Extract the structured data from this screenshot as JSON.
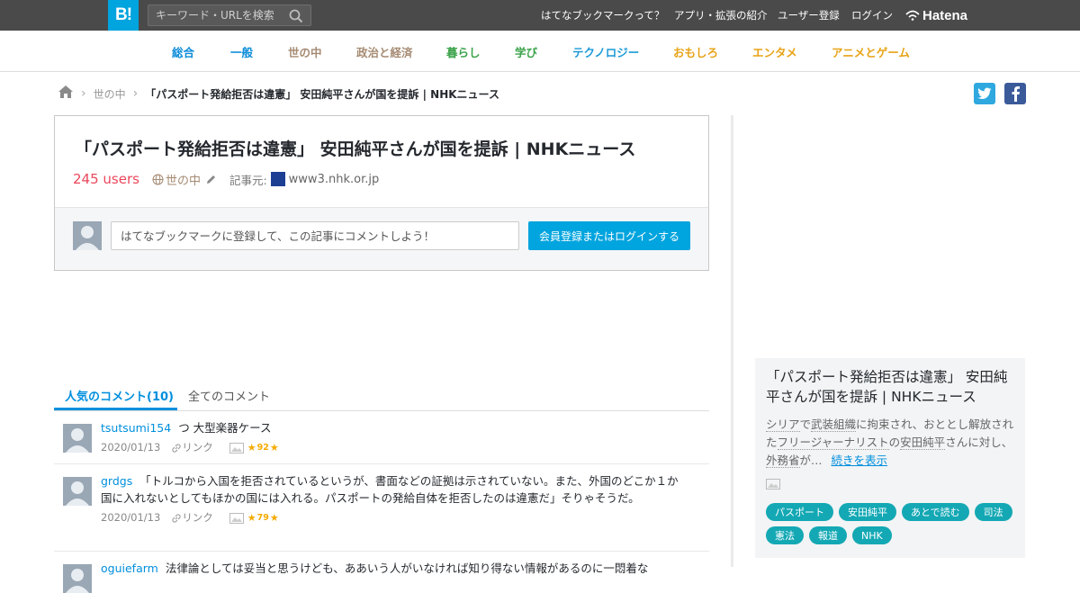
{
  "topbar": {
    "logo": "B!",
    "search_placeholder": "キーワード・URLを検索",
    "links": [
      "はてなブックマークって？",
      "アプリ・拡張の紹介",
      "ユーザー登録",
      "ログイン"
    ],
    "hatena": "Hatena"
  },
  "categories": [
    {
      "label": "総合",
      "color": "#0a8bd9"
    },
    {
      "label": "一般",
      "color": "#0a8bd9"
    },
    {
      "label": "世の中",
      "color": "#a58b73"
    },
    {
      "label": "政治と経済",
      "color": "#a58b73"
    },
    {
      "label": "暮らし",
      "color": "#3ba34a"
    },
    {
      "label": "学び",
      "color": "#3ba34a"
    },
    {
      "label": "テクノロジー",
      "color": "#1c9ad6"
    },
    {
      "label": "おもしろ",
      "color": "#e8a317"
    },
    {
      "label": "エンタメ",
      "color": "#e8a317"
    },
    {
      "label": "アニメとゲーム",
      "color": "#e8a317"
    }
  ],
  "breadcrumb": {
    "category": "世の中",
    "current": "「パスポート発給拒否は違憲」 安田純平さんが国を提訴 | NHKニュース"
  },
  "entry": {
    "title": "「パスポート発給拒否は違憲」 安田純平さんが国を提訴 | NHKニュース",
    "users": "245 users",
    "category": "世の中",
    "source_label": "記事元:",
    "source": "www3.nhk.or.jp",
    "comment_placeholder": "はてなブックマークに登録して、この記事にコメントしよう！",
    "login_button": "会員登録またはログインする"
  },
  "tabs": {
    "popular": "人気のコメント(10)",
    "all": "全てのコメント"
  },
  "comments": [
    {
      "user": "tsutsumi154",
      "text": "つ 大型楽器ケース",
      "date": "2020/01/13",
      "link": "リンク",
      "stars": "92"
    },
    {
      "user": "grdgs",
      "text": "「トルコから入国を拒否されているというが、書面などの証拠は示されていない。また、外国のどこか１か国に入れないとしてもほかの国には入れる。パスポートの発給自体を拒否したのは違憲だ」そりゃそうだ。",
      "date": "2020/01/13",
      "link": "リンク",
      "stars": "79"
    },
    {
      "user": "oguiefarm",
      "text": "法律論としては妥当と思うけども、ああいう人がいなければ知り得ない情報があるのに一悶着な",
      "date": "",
      "link": "",
      "stars": ""
    }
  ],
  "sidebar": {
    "title": "「パスポート発給拒否は違憲」 安田純平さんが国を提訴 | NHKニュース",
    "desc_parts": [
      "シリア",
      "で",
      "武装組織",
      "に拘束され、おととし解放された",
      "フリージャーナリスト",
      "の",
      "安田純平",
      "さんに対し、",
      "外務省",
      "が…"
    ],
    "more": "続きを表示",
    "tags": [
      "パスポート",
      "安田純平",
      "あとで読む",
      "司法",
      "憲法",
      "報道",
      "NHK"
    ]
  },
  "colors": {
    "accent": "#00a4de",
    "link": "#008fde",
    "users": "#ea475b",
    "tag": "#13a8b4",
    "star": "#f5ab00"
  }
}
